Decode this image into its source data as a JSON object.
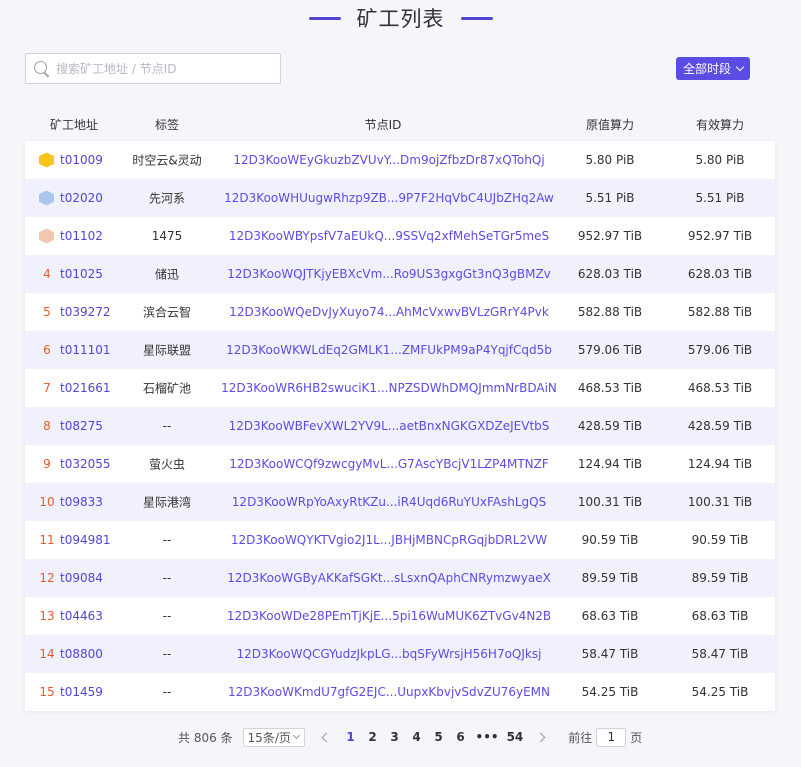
{
  "header": {
    "title": "矿工列表"
  },
  "search": {
    "placeholder": "搜索矿工地址 / 节点ID"
  },
  "filter": {
    "period_label": "全部时段"
  },
  "columns": {
    "address": "矿工地址",
    "tag": "标签",
    "node": "节点ID",
    "raw": "原值算力",
    "effective": "有效算力"
  },
  "rows": [
    {
      "rank": "1",
      "medal": "gold",
      "address": "t01009",
      "tag": "时空云&灵动",
      "node": "12D3KooWEyGkuzbZVUvY...Dm9ojZfbzDr87xQTohQj",
      "raw": "5.80 PiB",
      "effective": "5.80 PiB"
    },
    {
      "rank": "2",
      "medal": "silver",
      "address": "t02020",
      "tag": "先河系",
      "node": "12D3KooWHUugwRhzp9ZB...9P7F2HqVbC4UJbZHq2Aw",
      "raw": "5.51 PiB",
      "effective": "5.51 PiB"
    },
    {
      "rank": "3",
      "medal": "bronze",
      "address": "t01102",
      "tag": "1475",
      "node": "12D3KooWBYpsfV7aEUkQ...9SSVq2xfMehSeTGr5meS",
      "raw": "952.97 TiB",
      "effective": "952.97 TiB"
    },
    {
      "rank": "4",
      "medal": "",
      "address": "t01025",
      "tag": "储迅",
      "node": "12D3KooWQJTKjyEBXcVm...Ro9US3gxgGt3nQ3gBMZv",
      "raw": "628.03 TiB",
      "effective": "628.03 TiB"
    },
    {
      "rank": "5",
      "medal": "",
      "address": "t039272",
      "tag": "滨合云智",
      "node": "12D3KooWQeDvJyXuyo74...AhMcVxwvBVLzGRrY4Pvk",
      "raw": "582.88 TiB",
      "effective": "582.88 TiB"
    },
    {
      "rank": "6",
      "medal": "",
      "address": "t011101",
      "tag": "星际联盟",
      "node": "12D3KooWKWLdEq2GMLK1...ZMFUkPM9aP4YqjfCqd5b",
      "raw": "579.06 TiB",
      "effective": "579.06 TiB"
    },
    {
      "rank": "7",
      "medal": "",
      "address": "t021661",
      "tag": "石榴矿池",
      "node": "12D3KooWR6HB2swuciK1...NPZSDWhDMQJmmNrBDAiN",
      "raw": "468.53 TiB",
      "effective": "468.53 TiB"
    },
    {
      "rank": "8",
      "medal": "",
      "address": "t08275",
      "tag": "--",
      "node": "12D3KooWBFevXWL2YV9L...aetBnxNGKGXDZeJEVtbS",
      "raw": "428.59 TiB",
      "effective": "428.59 TiB"
    },
    {
      "rank": "9",
      "medal": "",
      "address": "t032055",
      "tag": "萤火虫",
      "node": "12D3KooWCQf9zwcgyMvL...G7AscYBcjV1LZP4MTNZF",
      "raw": "124.94 TiB",
      "effective": "124.94 TiB"
    },
    {
      "rank": "10",
      "medal": "",
      "address": "t09833",
      "tag": "星际港湾",
      "node": "12D3KooWRpYoAxyRtKZu...iR4Uqd6RuYUxFAshLgQS",
      "raw": "100.31 TiB",
      "effective": "100.31 TiB"
    },
    {
      "rank": "11",
      "medal": "",
      "address": "t094981",
      "tag": "--",
      "node": "12D3KooWQYKTVgio2J1L...JBHjMBNCpRGqjbDRL2VW",
      "raw": "90.59 TiB",
      "effective": "90.59 TiB"
    },
    {
      "rank": "12",
      "medal": "",
      "address": "t09084",
      "tag": "--",
      "node": "12D3KooWGByAKKafSGKt...sLsxnQAphCNRymzwyaeX",
      "raw": "89.59 TiB",
      "effective": "89.59 TiB"
    },
    {
      "rank": "13",
      "medal": "",
      "address": "t04463",
      "tag": "--",
      "node": "12D3KooWDe28PEmTjKjE...5pi16WuMUK6ZTvGv4N2B",
      "raw": "68.63 TiB",
      "effective": "68.63 TiB"
    },
    {
      "rank": "14",
      "medal": "",
      "address": "t08800",
      "tag": "--",
      "node": "12D3KooWQCGYudzJkpLG...bqSFyWrsjH56H7oQJksj",
      "raw": "58.47 TiB",
      "effective": "58.47 TiB"
    },
    {
      "rank": "15",
      "medal": "",
      "address": "t01459",
      "tag": "--",
      "node": "12D3KooWKmdU7gfG2EJC...UupxKbvjvSdvZU76yEMN",
      "raw": "54.25 TiB",
      "effective": "54.25 TiB"
    }
  ],
  "pagination": {
    "total_text": "共 806 条",
    "page_size": "15条/页",
    "pages": [
      "1",
      "2",
      "3",
      "4",
      "5",
      "6",
      "•••",
      "54"
    ],
    "current": "1",
    "goto_label": "前往",
    "goto_value": "1",
    "goto_suffix": "页"
  },
  "colors": {
    "accent": "#5b4ce6",
    "link": "#4f46d5",
    "rank": "#e45b2c",
    "stripe": "#f0f1fc"
  }
}
